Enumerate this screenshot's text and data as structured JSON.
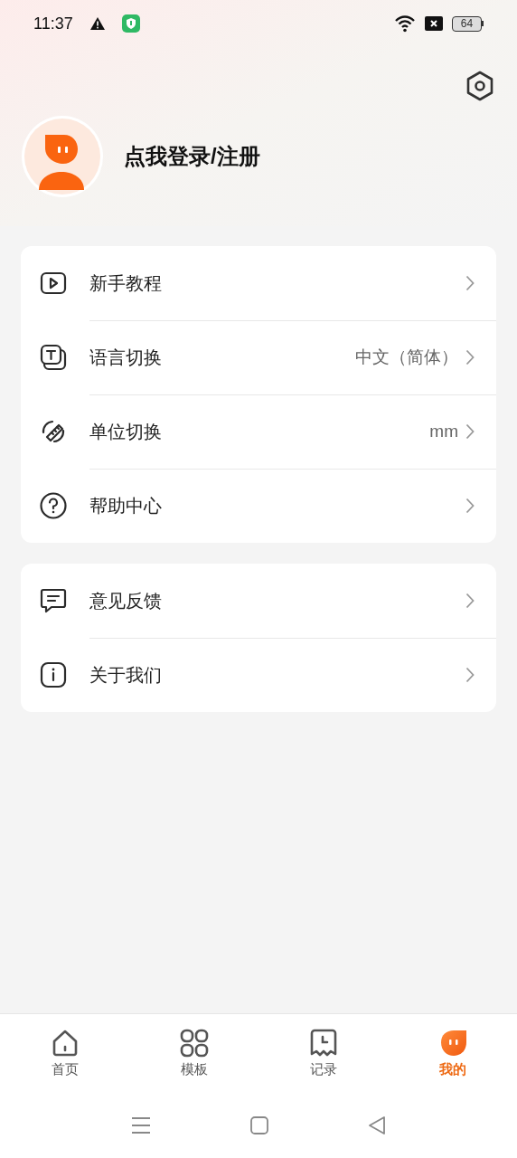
{
  "status_bar": {
    "time": "11:37",
    "battery": "64"
  },
  "profile": {
    "login_text": "点我登录/注册"
  },
  "menu_groups": [
    {
      "items": [
        {
          "kind": "video",
          "label": "新手教程"
        },
        {
          "kind": "language",
          "label": "语言切换",
          "value": "中文（简体）"
        },
        {
          "kind": "unit",
          "label": "单位切换",
          "value": "mm"
        },
        {
          "kind": "help",
          "label": "帮助中心"
        }
      ]
    },
    {
      "items": [
        {
          "kind": "feedback",
          "label": "意见反馈"
        },
        {
          "kind": "about",
          "label": "关于我们"
        }
      ]
    }
  ],
  "tabs": [
    {
      "kind": "home",
      "label": "首页",
      "selected": false
    },
    {
      "kind": "templates",
      "label": "模板",
      "selected": false
    },
    {
      "kind": "records",
      "label": "记录",
      "selected": false
    },
    {
      "kind": "mine",
      "label": "我的",
      "selected": true
    }
  ]
}
